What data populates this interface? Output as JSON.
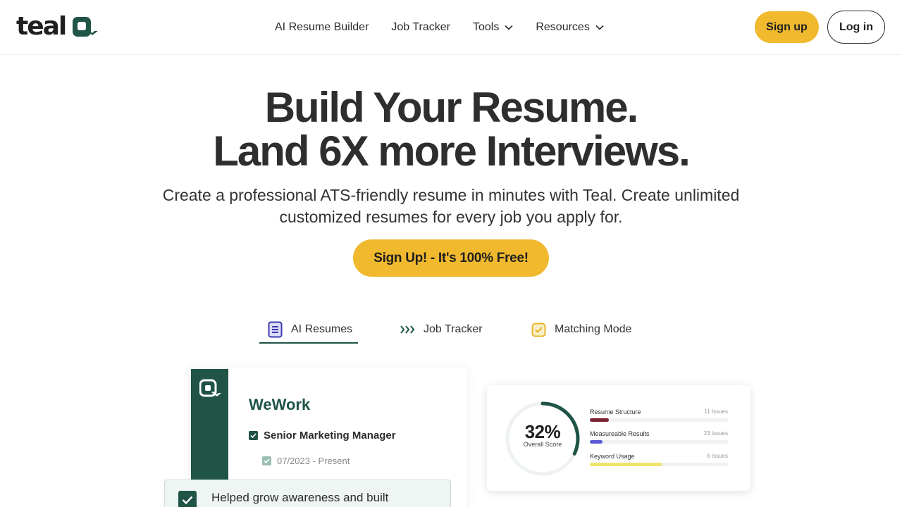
{
  "brand": {
    "name": "teal",
    "accent": "#1f5447",
    "cta_color": "#f0b92e"
  },
  "nav": {
    "items": [
      {
        "label": "AI Resume Builder",
        "dropdown": false
      },
      {
        "label": "Job Tracker",
        "dropdown": false
      },
      {
        "label": "Tools",
        "dropdown": true
      },
      {
        "label": "Resources",
        "dropdown": true
      }
    ],
    "signup_label": "Sign up",
    "login_label": "Log in"
  },
  "hero": {
    "title_line1": "Build Your Resume.",
    "title_line2": "Land 6X more Interviews.",
    "subtitle_line1": "Create a professional ATS-friendly resume in minutes with Teal. Create unlimited",
    "subtitle_line2": "customized resumes for every job you apply for.",
    "cta_label": "Sign Up! - It's 100% Free!"
  },
  "tabs": [
    {
      "label": "AI Resumes",
      "icon": "document-icon",
      "active": true
    },
    {
      "label": "Job Tracker",
      "icon": "chevrons-right-icon",
      "active": false
    },
    {
      "label": "Matching Mode",
      "icon": "checkbox-icon",
      "active": false
    }
  ],
  "preview": {
    "resume": {
      "company": "WeWork",
      "job_title": "Senior Marketing Manager",
      "date": "07/2023 - Present",
      "bullet": "Helped grow awareness and built"
    },
    "score": {
      "value": "32%",
      "fraction": 0.32,
      "label": "Overall Score",
      "metrics": [
        {
          "name": "Resume Structure",
          "count": "11 Issues",
          "fill": 0.14,
          "color": "#7b2233"
        },
        {
          "name": "Measureable Results",
          "count": "23 Issues",
          "fill": 0.09,
          "color": "#5b5bd6"
        },
        {
          "name": "Keyword Usage",
          "count": "6 Issues",
          "fill": 0.52,
          "color": "#f2e56b"
        }
      ]
    }
  }
}
